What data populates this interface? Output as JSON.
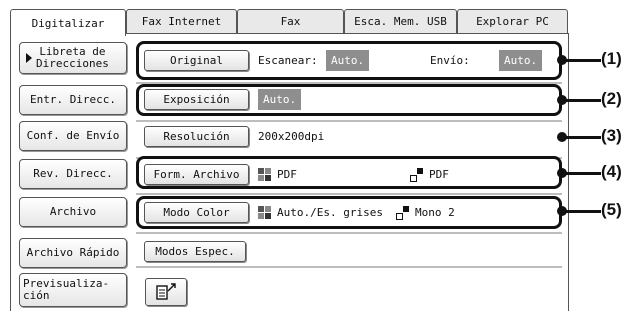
{
  "tabs": [
    "Digitalizar",
    "Fax Internet",
    "Fax",
    "Esca. Mem. USB",
    "Explorar PC"
  ],
  "sidebar": {
    "libreta": "Libreta de\nDirecciones",
    "entr": "Entr. Direcc.",
    "conf": "Conf. de Envío",
    "rev": "Rev. Direcc.",
    "archivo": "Archivo",
    "rapido": "Archivo Rápido",
    "preview": "Previsualiza-\nción"
  },
  "rows": {
    "original": {
      "button": "Original",
      "scan_label": "Escanear:",
      "scan_value": "Auto.",
      "send_label": "Envío:",
      "send_value": "Auto."
    },
    "exposicion": {
      "button": "Exposición",
      "value": "Auto."
    },
    "resolucion": {
      "button": "Resolución",
      "value": "200x200dpi"
    },
    "formato": {
      "button": "Form. Archivo",
      "value_color": "PDF",
      "value_mono": "PDF"
    },
    "modo_color": {
      "button": "Modo Color",
      "value_color": "Auto./Es. grises",
      "value_mono": "Mono 2"
    },
    "modos": {
      "button": "Modos Espec."
    }
  },
  "callouts": [
    "(1)",
    "(2)",
    "(3)",
    "(4)",
    "(5)"
  ],
  "icons": [
    "triangle-right-icon",
    "preview-icon",
    "color-mode-icon",
    "mono-mode-icon"
  ],
  "colors": {
    "badge": "#8e8e8e",
    "frame": "#111111"
  }
}
